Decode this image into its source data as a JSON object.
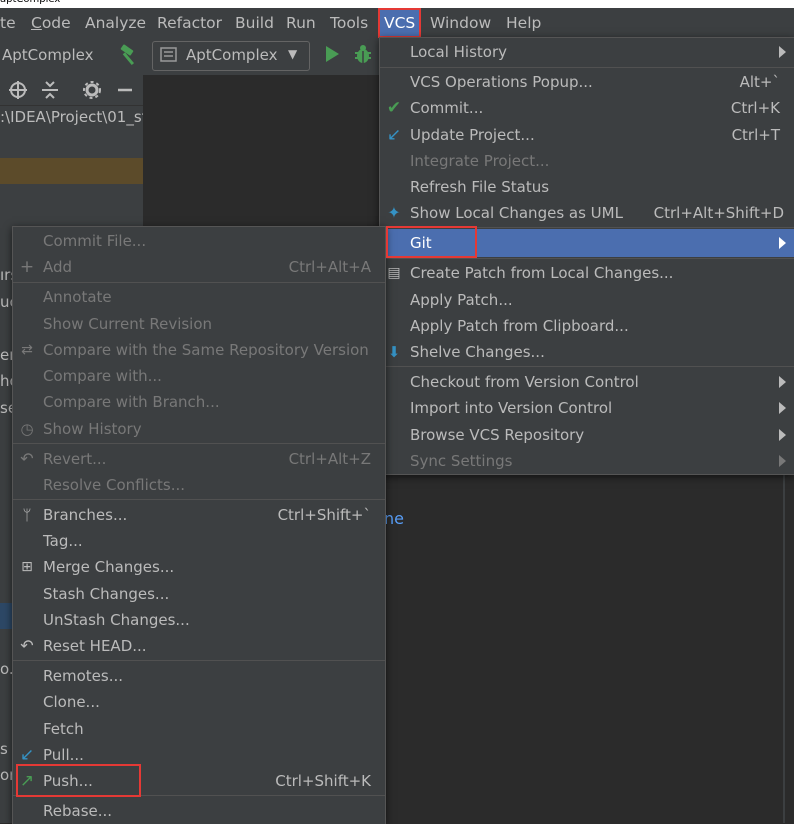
{
  "menubar": {
    "items": [
      "te",
      "Code",
      "Analyze",
      "Refactor",
      "Build",
      "Run",
      "Tools",
      "VCS",
      "Window",
      "Help"
    ]
  },
  "toolbar": {
    "project_name": "AptComplex",
    "run_config": "AptComplex"
  },
  "project_panel": {
    "path": ":\\IDEA\\Project\\01_st",
    "clipped_rows": [
      "ırs",
      "uc",
      "er",
      "ho",
      "se",
      "o.i",
      "s",
      "or"
    ]
  },
  "editor": {
    "code_fragment": "ne"
  },
  "vcs_menu": {
    "items": [
      {
        "label": "Local History",
        "shortcut": "",
        "submenu": true
      },
      {
        "label": "VCS Operations Popup...",
        "shortcut": "Alt+`"
      },
      {
        "label": "Commit...",
        "shortcut": "Ctrl+K",
        "icon": "check-icon"
      },
      {
        "label": "Update Project...",
        "shortcut": "Ctrl+T",
        "icon": "update-arrow-icon"
      },
      {
        "label": "Integrate Project...",
        "shortcut": "",
        "disabled": true
      },
      {
        "label": "Refresh File Status",
        "shortcut": ""
      },
      {
        "label": "Show Local Changes as UML",
        "shortcut": "Ctrl+Alt+Shift+D",
        "icon": "uml-icon"
      },
      {
        "label": "Git",
        "shortcut": "",
        "submenu": true,
        "selected": true
      },
      {
        "label": "Create Patch from Local Changes...",
        "shortcut": "",
        "icon": "patch-icon"
      },
      {
        "label": "Apply Patch...",
        "shortcut": ""
      },
      {
        "label": "Apply Patch from Clipboard...",
        "shortcut": ""
      },
      {
        "label": "Shelve Changes...",
        "shortcut": "",
        "icon": "shelve-icon"
      },
      {
        "label": "Checkout from Version Control",
        "shortcut": "",
        "submenu": true
      },
      {
        "label": "Import into Version Control",
        "shortcut": "",
        "submenu": true
      },
      {
        "label": "Browse VCS Repository",
        "shortcut": "",
        "submenu": true
      },
      {
        "label": "Sync Settings",
        "shortcut": "",
        "submenu": true,
        "disabled": true
      }
    ]
  },
  "git_menu": {
    "items": [
      {
        "label": "Commit File...",
        "shortcut": "",
        "disabled": true
      },
      {
        "label": "Add",
        "shortcut": "Ctrl+Alt+A",
        "disabled": true,
        "icon": "plus-icon"
      },
      {
        "label": "Annotate",
        "shortcut": "",
        "disabled": true
      },
      {
        "label": "Show Current Revision",
        "shortcut": "",
        "disabled": true
      },
      {
        "label": "Compare with the Same Repository Version",
        "shortcut": "",
        "disabled": true,
        "icon": "compare-icon"
      },
      {
        "label": "Compare with...",
        "shortcut": "",
        "disabled": true
      },
      {
        "label": "Compare with Branch...",
        "shortcut": "",
        "disabled": true
      },
      {
        "label": "Show History",
        "shortcut": "",
        "disabled": true,
        "icon": "history-icon"
      },
      {
        "label": "Revert...",
        "shortcut": "Ctrl+Alt+Z",
        "disabled": true,
        "icon": "revert-icon"
      },
      {
        "label": "Resolve Conflicts...",
        "shortcut": "",
        "disabled": true
      },
      {
        "label": "Branches...",
        "shortcut": "Ctrl+Shift+`",
        "icon": "branch-icon"
      },
      {
        "label": "Tag...",
        "shortcut": ""
      },
      {
        "label": "Merge Changes...",
        "shortcut": "",
        "icon": "merge-icon"
      },
      {
        "label": "Stash Changes...",
        "shortcut": ""
      },
      {
        "label": "UnStash Changes...",
        "shortcut": ""
      },
      {
        "label": "Reset HEAD...",
        "shortcut": "",
        "icon": "reset-icon"
      },
      {
        "label": "Remotes...",
        "shortcut": ""
      },
      {
        "label": "Clone...",
        "shortcut": ""
      },
      {
        "label": "Fetch",
        "shortcut": ""
      },
      {
        "label": "Pull...",
        "shortcut": "",
        "icon": "pull-icon"
      },
      {
        "label": "Push...",
        "shortcut": "Ctrl+Shift+K",
        "icon": "push-icon"
      },
      {
        "label": "Rebase...",
        "shortcut": ""
      }
    ]
  },
  "colors": {
    "menu_bg": "#3c3f41",
    "selection": "#4b6eaf",
    "highlight_box": "#e53935",
    "accent_green": "#499c54",
    "accent_blue": "#3592c4"
  }
}
